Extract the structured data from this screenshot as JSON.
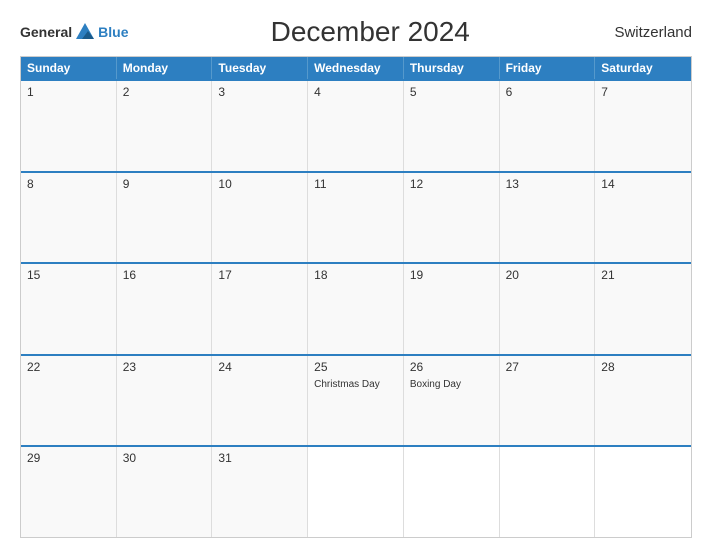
{
  "header": {
    "title": "December 2024",
    "country": "Switzerland",
    "logo": {
      "general": "General",
      "blue": "Blue"
    }
  },
  "calendar": {
    "days_of_week": [
      "Sunday",
      "Monday",
      "Tuesday",
      "Wednesday",
      "Thursday",
      "Friday",
      "Saturday"
    ],
    "weeks": [
      [
        {
          "day": 1,
          "holiday": ""
        },
        {
          "day": 2,
          "holiday": ""
        },
        {
          "day": 3,
          "holiday": ""
        },
        {
          "day": 4,
          "holiday": ""
        },
        {
          "day": 5,
          "holiday": ""
        },
        {
          "day": 6,
          "holiday": ""
        },
        {
          "day": 7,
          "holiday": ""
        }
      ],
      [
        {
          "day": 8,
          "holiday": ""
        },
        {
          "day": 9,
          "holiday": ""
        },
        {
          "day": 10,
          "holiday": ""
        },
        {
          "day": 11,
          "holiday": ""
        },
        {
          "day": 12,
          "holiday": ""
        },
        {
          "day": 13,
          "holiday": ""
        },
        {
          "day": 14,
          "holiday": ""
        }
      ],
      [
        {
          "day": 15,
          "holiday": ""
        },
        {
          "day": 16,
          "holiday": ""
        },
        {
          "day": 17,
          "holiday": ""
        },
        {
          "day": 18,
          "holiday": ""
        },
        {
          "day": 19,
          "holiday": ""
        },
        {
          "day": 20,
          "holiday": ""
        },
        {
          "day": 21,
          "holiday": ""
        }
      ],
      [
        {
          "day": 22,
          "holiday": ""
        },
        {
          "day": 23,
          "holiday": ""
        },
        {
          "day": 24,
          "holiday": ""
        },
        {
          "day": 25,
          "holiday": "Christmas Day"
        },
        {
          "day": 26,
          "holiday": "Boxing Day"
        },
        {
          "day": 27,
          "holiday": ""
        },
        {
          "day": 28,
          "holiday": ""
        }
      ],
      [
        {
          "day": 29,
          "holiday": ""
        },
        {
          "day": 30,
          "holiday": ""
        },
        {
          "day": 31,
          "holiday": ""
        },
        {
          "day": null,
          "holiday": ""
        },
        {
          "day": null,
          "holiday": ""
        },
        {
          "day": null,
          "holiday": ""
        },
        {
          "day": null,
          "holiday": ""
        }
      ]
    ]
  }
}
